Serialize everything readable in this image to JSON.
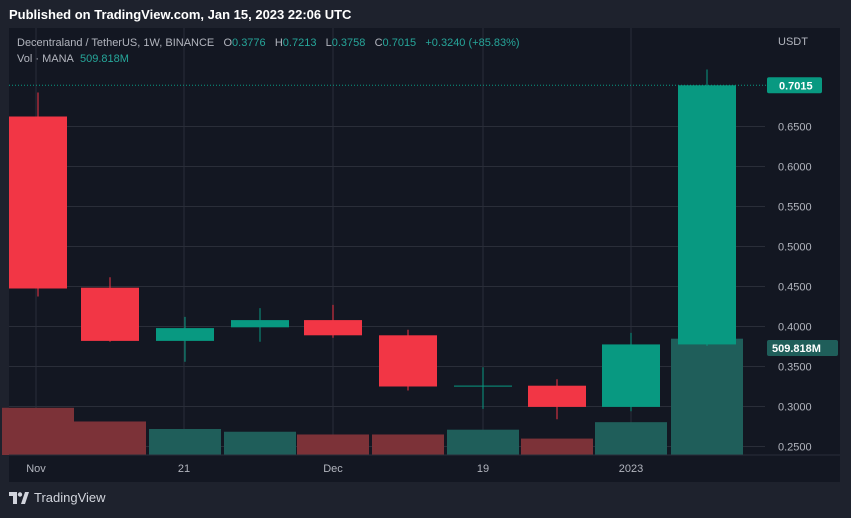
{
  "header": {
    "published": "Published on TradingView.com, Jan 15, 2023 22:06 UTC"
  },
  "legend": {
    "symbol": "Decentraland / TetherUS, 1W, BINANCE",
    "open_label": "O",
    "open": "0.3776",
    "high_label": "H",
    "high": "0.7213",
    "low_label": "L",
    "low": "0.3758",
    "close_label": "C",
    "close": "0.7015",
    "change": "+0.3240 (+85.83%)",
    "vol_label": "Vol · MANA",
    "vol_value": "509.818M"
  },
  "footer": {
    "brand": "TradingView"
  },
  "colors": {
    "up": "#089981",
    "down": "#f23645",
    "vol_up": "#1f5e5a",
    "vol_down": "#7c3238",
    "grid": "#2a2e39",
    "background": "#131722"
  },
  "chart_data": {
    "type": "candlestick",
    "currency": "USDT",
    "ylim": [
      0.24,
      0.74
    ],
    "yticks": [
      "0.2500",
      "0.3000",
      "0.3500",
      "0.4000",
      "0.4500",
      "0.5000",
      "0.5500",
      "0.6000",
      "0.6500"
    ],
    "xticks": [
      "Nov",
      "21",
      "Dec",
      "19",
      "2023"
    ],
    "last_price_label": "0.7015",
    "last_volume_label": "509.818M",
    "candles": [
      {
        "open": 0.6625,
        "high": 0.6925,
        "low": 0.4375,
        "close": 0.4475,
        "volume": 69
      },
      {
        "open": 0.4485,
        "high": 0.4615,
        "low": 0.381,
        "close": 0.382,
        "volume": 49
      },
      {
        "open": 0.382,
        "high": 0.412,
        "low": 0.356,
        "close": 0.398,
        "volume": 38
      },
      {
        "open": 0.399,
        "high": 0.423,
        "low": 0.381,
        "close": 0.408,
        "volume": 34
      },
      {
        "open": 0.408,
        "high": 0.427,
        "low": 0.386,
        "close": 0.389,
        "volume": 30
      },
      {
        "open": 0.389,
        "high": 0.396,
        "low": 0.32,
        "close": 0.325,
        "volume": 30
      },
      {
        "open": 0.3248,
        "high": 0.349,
        "low": 0.297,
        "close": 0.3255,
        "volume": 37
      },
      {
        "open": 0.326,
        "high": 0.334,
        "low": 0.284,
        "close": 0.2995,
        "volume": 24
      },
      {
        "open": 0.2995,
        "high": 0.392,
        "low": 0.294,
        "close": 0.3776,
        "volume": 48
      },
      {
        "open": 0.3776,
        "high": 0.7213,
        "low": 0.3758,
        "close": 0.7015,
        "volume": 170
      }
    ],
    "volume_max": 190
  }
}
